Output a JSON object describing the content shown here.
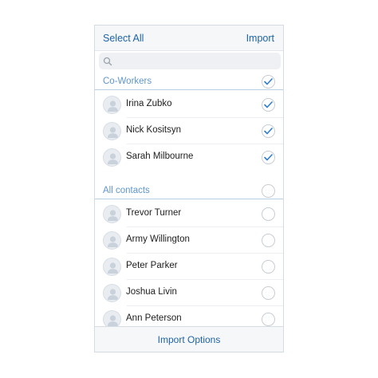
{
  "header": {
    "select_all_label": "Select All",
    "import_label": "Import"
  },
  "search": {
    "placeholder": "",
    "value": ""
  },
  "sections": {
    "coworkers": {
      "title": "Co-Workers",
      "checked": true,
      "contacts": [
        {
          "name": "Irina Zubko",
          "checked": true
        },
        {
          "name": "Nick Kositsyn",
          "checked": true
        },
        {
          "name": "Sarah Milbourne",
          "checked": true
        }
      ]
    },
    "all_contacts": {
      "title": "All contacts",
      "checked": false,
      "contacts": [
        {
          "name": "Trevor Turner",
          "checked": false
        },
        {
          "name": "Army Willington",
          "checked": false
        },
        {
          "name": "Peter Parker",
          "checked": false
        },
        {
          "name": "Joshua Livin",
          "checked": false
        },
        {
          "name": "Ann Peterson",
          "checked": false
        }
      ]
    }
  },
  "footer": {
    "import_options_label": "Import Options"
  },
  "colors": {
    "accent": "#1e63a5",
    "section_header": "#5f96cc",
    "check_blue": "#2f7fd1"
  }
}
